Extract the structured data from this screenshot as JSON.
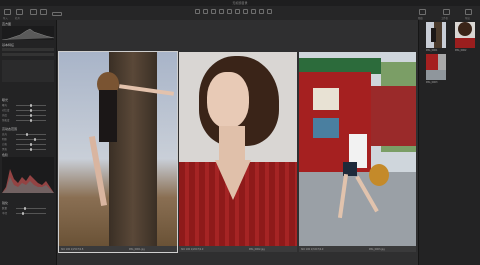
{
  "window": {
    "title": "无标题目录"
  },
  "toolbar": {
    "items": [
      "导入",
      "打开",
      "",
      "",
      "",
      "",
      "",
      "",
      "",
      ""
    ],
    "right_labels": [
      "预览",
      "工作区",
      "导出"
    ]
  },
  "left_panel": {
    "sections": [
      {
        "title": "直方图"
      },
      {
        "title": "基本特征"
      },
      {
        "title": "曝光"
      },
      {
        "title": "高动态范围"
      },
      {
        "title": "色阶"
      },
      {
        "title": "锐化"
      }
    ],
    "exposure_rows": [
      "曝光",
      "对比度",
      "亮度",
      "饱和度"
    ],
    "hdr_rows": [
      "高光",
      "阴影",
      "白色",
      "黑色"
    ],
    "sharp_rows": [
      "数量",
      "半径"
    ]
  },
  "viewer": {
    "images": [
      {
        "caption_left": "ISO 100  1/250  f/2.8",
        "caption_right": "IMG_0001.jpg"
      },
      {
        "caption_left": "ISO 100  1/200  f/2.0",
        "caption_right": "IMG_0002.jpg"
      },
      {
        "caption_left": "ISO 100  1/320  f/4.0",
        "caption_right": "IMG_0003.jpg"
      }
    ]
  },
  "right_panel": {
    "thumbnails": [
      {
        "label": "IMG_0001"
      },
      {
        "label": "IMG_0002"
      },
      {
        "label": "IMG_0003"
      }
    ]
  }
}
